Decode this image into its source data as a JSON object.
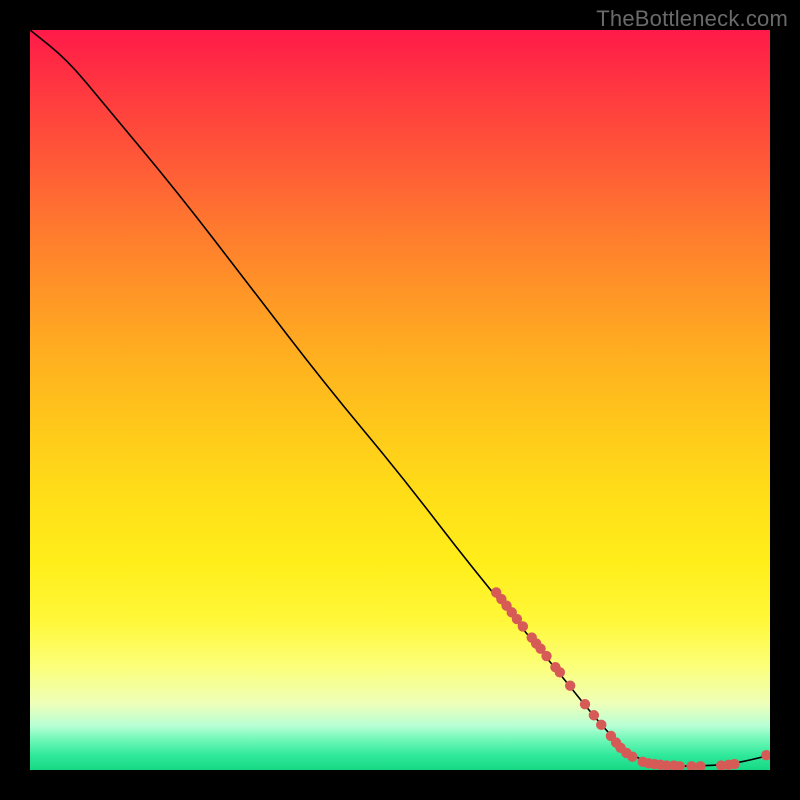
{
  "watermark": "TheBottleneck.com",
  "chart_data": {
    "type": "line",
    "title": "",
    "xlabel": "",
    "ylabel": "",
    "xlim": [
      0,
      100
    ],
    "ylim": [
      0,
      100
    ],
    "curve": [
      {
        "x": 0,
        "y": 100
      },
      {
        "x": 5,
        "y": 96
      },
      {
        "x": 10,
        "y": 90
      },
      {
        "x": 20,
        "y": 78
      },
      {
        "x": 30,
        "y": 65
      },
      {
        "x": 40,
        "y": 52
      },
      {
        "x": 50,
        "y": 40
      },
      {
        "x": 60,
        "y": 27
      },
      {
        "x": 70,
        "y": 15
      },
      {
        "x": 78,
        "y": 5
      },
      {
        "x": 82,
        "y": 1.5
      },
      {
        "x": 85,
        "y": 0.6
      },
      {
        "x": 90,
        "y": 0.5
      },
      {
        "x": 95,
        "y": 0.8
      },
      {
        "x": 100,
        "y": 2.0
      }
    ],
    "markers": [
      {
        "x": 63.0,
        "y": 24.0
      },
      {
        "x": 63.7,
        "y": 23.1
      },
      {
        "x": 64.4,
        "y": 22.2
      },
      {
        "x": 65.1,
        "y": 21.3
      },
      {
        "x": 65.8,
        "y": 20.4
      },
      {
        "x": 66.6,
        "y": 19.4
      },
      {
        "x": 67.8,
        "y": 17.9
      },
      {
        "x": 68.4,
        "y": 17.1
      },
      {
        "x": 69.0,
        "y": 16.4
      },
      {
        "x": 69.8,
        "y": 15.4
      },
      {
        "x": 71.0,
        "y": 13.9
      },
      {
        "x": 71.6,
        "y": 13.2
      },
      {
        "x": 73.0,
        "y": 11.4
      },
      {
        "x": 75.0,
        "y": 8.9
      },
      {
        "x": 76.2,
        "y": 7.4
      },
      {
        "x": 77.2,
        "y": 6.1
      },
      {
        "x": 78.5,
        "y": 4.6
      },
      {
        "x": 79.2,
        "y": 3.7
      },
      {
        "x": 79.8,
        "y": 3.0
      },
      {
        "x": 80.6,
        "y": 2.3
      },
      {
        "x": 81.4,
        "y": 1.8
      },
      {
        "x": 82.8,
        "y": 1.1
      },
      {
        "x": 83.6,
        "y": 0.9
      },
      {
        "x": 84.4,
        "y": 0.8
      },
      {
        "x": 85.2,
        "y": 0.7
      },
      {
        "x": 86.0,
        "y": 0.6
      },
      {
        "x": 87.0,
        "y": 0.6
      },
      {
        "x": 87.8,
        "y": 0.5
      },
      {
        "x": 89.4,
        "y": 0.5
      },
      {
        "x": 90.6,
        "y": 0.5
      },
      {
        "x": 93.4,
        "y": 0.6
      },
      {
        "x": 94.4,
        "y": 0.7
      },
      {
        "x": 95.2,
        "y": 0.8
      },
      {
        "x": 99.5,
        "y": 2.0
      }
    ],
    "marker_color": "#d65a56",
    "curve_color": "#000000"
  }
}
